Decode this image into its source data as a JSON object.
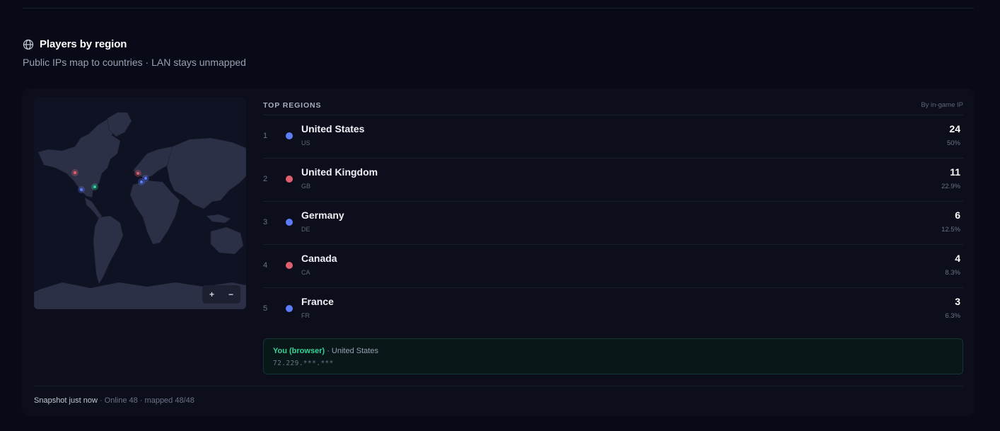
{
  "section": {
    "title": "Players by region",
    "subtitle": "Public IPs map to countries · LAN stays unmapped"
  },
  "map": {
    "zoom_in": "+",
    "zoom_out": "−",
    "markers": [
      {
        "color": "#e05f6e"
      },
      {
        "color": "#5c7cfa"
      },
      {
        "color": "#34d399"
      },
      {
        "color": "#e05f6e"
      },
      {
        "color": "#5c7cfa"
      },
      {
        "color": "#5c7cfa"
      }
    ]
  },
  "regions": {
    "title": "TOP REGIONS",
    "note": "By in-game IP",
    "rows": [
      {
        "rank": "1",
        "name": "United States",
        "code": "US",
        "count": "24",
        "pct": "50%",
        "color": "#5c7cfa"
      },
      {
        "rank": "2",
        "name": "United Kingdom",
        "code": "GB",
        "count": "11",
        "pct": "22.9%",
        "color": "#e05f6e"
      },
      {
        "rank": "3",
        "name": "Germany",
        "code": "DE",
        "count": "6",
        "pct": "12.5%",
        "color": "#5c7cfa"
      },
      {
        "rank": "4",
        "name": "Canada",
        "code": "CA",
        "count": "4",
        "pct": "8.3%",
        "color": "#e05f6e"
      },
      {
        "rank": "5",
        "name": "France",
        "code": "FR",
        "count": "3",
        "pct": "6.3%",
        "color": "#5c7cfa"
      }
    ]
  },
  "you": {
    "label": "You (browser)",
    "separator": " · ",
    "country": "United States",
    "ip": "72.229.***.***"
  },
  "footer": {
    "prefix": "Snapshot ",
    "time": "just now",
    "details": " · Online 48 · mapped 48/48"
  },
  "colors": {
    "accent_green": "#34d399",
    "marker_red": "#e05f6e",
    "marker_blue": "#5c7cfa"
  }
}
